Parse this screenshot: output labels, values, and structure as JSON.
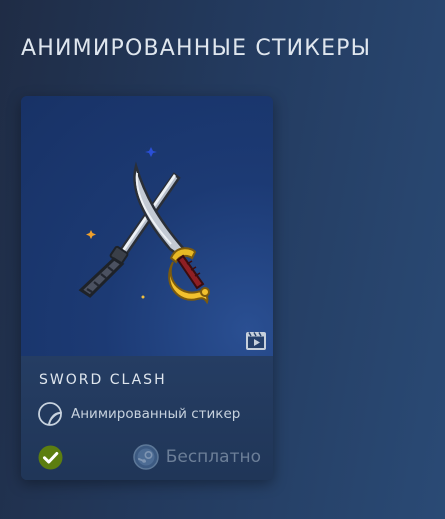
{
  "section": {
    "title": "АНИМИРОВАННЫЕ СТИКЕРЫ"
  },
  "card": {
    "title": "SWORD CLASH",
    "type_label": "Анимированный стикер",
    "price_label": "Бесплатно",
    "owned": true
  },
  "icons": {
    "video": "video-clapper-icon",
    "sticker": "sticker-peel-icon",
    "owned": "checkmark-icon",
    "currency": "steam-points-icon"
  },
  "colors": {
    "owned_green": "#5c7e10",
    "price_text": "#6c7f98",
    "sparkle_blue": "#2a4fd6",
    "sparkle_orange": "#f0a02c"
  }
}
